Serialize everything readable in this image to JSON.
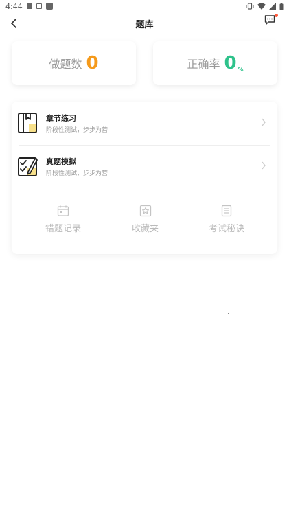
{
  "status_bar": {
    "time": "4:44"
  },
  "nav": {
    "title": "题库"
  },
  "stats": {
    "done": {
      "label": "做题数",
      "value": "0",
      "color": "#f59a1b"
    },
    "accuracy": {
      "label": "正确率",
      "value": "0",
      "unit": "%",
      "color": "#2ec28b"
    }
  },
  "practice": [
    {
      "name": "章节练习",
      "desc": "阶段性测试，步步为营",
      "icon": "book-icon"
    },
    {
      "name": "真题模拟",
      "desc": "阶段性测试，步步为营",
      "icon": "checklist-pencil-icon"
    }
  ],
  "tools": [
    {
      "label": "错题记录",
      "icon": "calendar-icon"
    },
    {
      "label": "收藏夹",
      "icon": "star-box-icon"
    },
    {
      "label": "考试秘诀",
      "icon": "document-icon"
    }
  ],
  "colors": {
    "accent_yellow": "#f7e08a",
    "muted": "#bbbbbb"
  }
}
